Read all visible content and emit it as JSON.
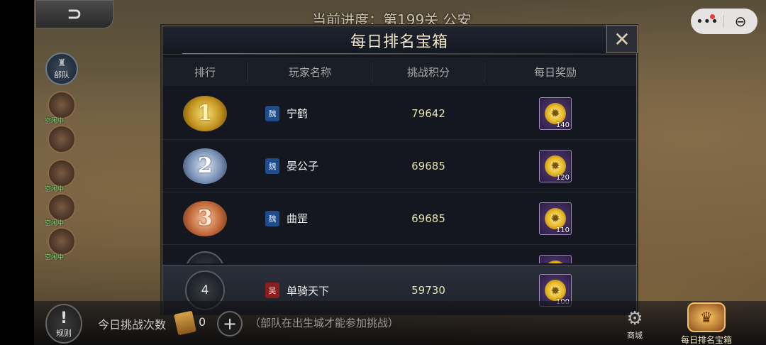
{
  "top": {
    "progress": "当前进度：第199关 公安"
  },
  "capsule": {
    "more": "•••",
    "close": "⊖"
  },
  "army": {
    "title": "部队",
    "heroes": [
      {
        "status": "空闲中"
      },
      {
        "status": ""
      },
      {
        "status": "空闲中"
      },
      {
        "status": "空闲中"
      },
      {
        "status": "空闲中"
      }
    ]
  },
  "modal": {
    "title": "每日排名宝箱",
    "close": "✕",
    "columns": [
      "排行",
      "玩家名称",
      "挑战积分",
      "每日奖励"
    ],
    "rows": [
      {
        "rank": "1",
        "faction": "魏",
        "name": "宁鹤",
        "score": "79642",
        "reward": "140"
      },
      {
        "rank": "2",
        "faction": "魏",
        "name": "晏公子",
        "score": "69685",
        "reward": "120"
      },
      {
        "rank": "3",
        "faction": "魏",
        "name": "曲罡",
        "score": "69685",
        "reward": "110"
      }
    ],
    "my_row": {
      "rank": "4",
      "faction": "吴",
      "name": "单骑天下",
      "score": "59730",
      "reward": "100"
    }
  },
  "bottom": {
    "rules": "规则",
    "attempts_label": "今日挑战次数",
    "attempts_value": "0",
    "hint": "（部队在出生城才能参加挑战）",
    "shop": "商城",
    "chest": "每日排名宝箱"
  },
  "colors": {
    "modal_bg": "#14171f",
    "score": "#e4e0b0",
    "reward_frame": "#9a8ab8"
  }
}
